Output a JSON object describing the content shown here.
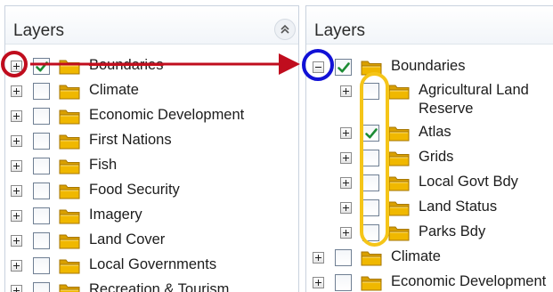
{
  "left_panel": {
    "title": "Layers",
    "items": [
      {
        "label": "Boundaries",
        "checked": true
      },
      {
        "label": "Climate",
        "checked": false
      },
      {
        "label": "Economic Development",
        "checked": false
      },
      {
        "label": "First Nations",
        "checked": false
      },
      {
        "label": "Fish",
        "checked": false
      },
      {
        "label": "Food Security",
        "checked": false
      },
      {
        "label": "Imagery",
        "checked": false
      },
      {
        "label": "Land Cover",
        "checked": false
      },
      {
        "label": "Local Governments",
        "checked": false
      },
      {
        "label": "Recreation & Tourism",
        "checked": false
      }
    ]
  },
  "right_panel": {
    "title": "Layers",
    "parent": {
      "label": "Boundaries",
      "checked": true,
      "expanded": true
    },
    "children": [
      {
        "label": "Agricultural Land Reserve",
        "checked": false
      },
      {
        "label": "Atlas",
        "checked": true
      },
      {
        "label": "Grids",
        "checked": false
      },
      {
        "label": "Local Govt Bdy",
        "checked": false
      },
      {
        "label": "Land Status",
        "checked": false
      },
      {
        "label": "Parks Bdy",
        "checked": false
      }
    ],
    "siblings": [
      {
        "label": "Climate",
        "checked": false
      },
      {
        "label": "Economic Development",
        "checked": false
      }
    ]
  },
  "annotation_colors": {
    "red": "#c00d1e",
    "blue": "#1111d6",
    "yellow": "#f5c518",
    "checkmark": "#1d8c35",
    "folder": "#f0b800"
  }
}
